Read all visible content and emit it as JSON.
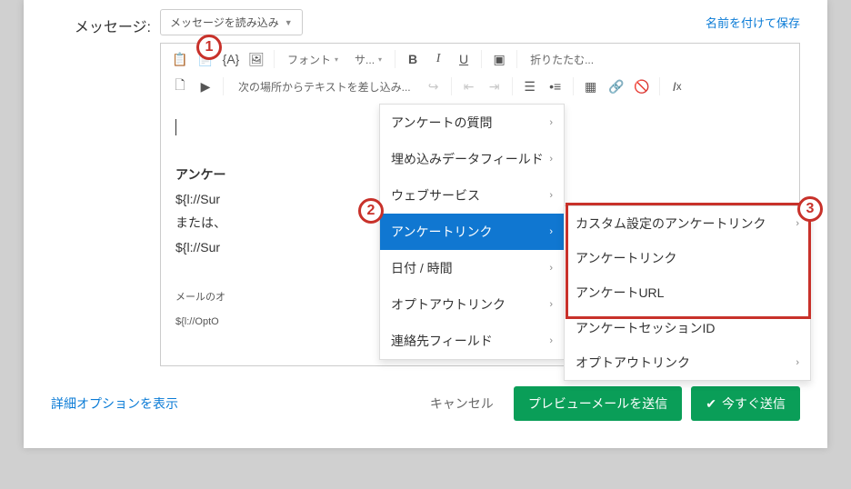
{
  "label": "メッセージ:",
  "loadBtn": "メッセージを読み込み",
  "saveAs": "名前を付けて保存",
  "toolbar": {
    "font": "フォント",
    "size": "サ...",
    "fold": "折りたたむ...",
    "piped": "次の場所からテキストを差し込み..."
  },
  "canvas": {
    "heading1": "アンケー",
    "ref1": "${l://Sur",
    "line2": "または、",
    "ref2": "${l://Sur",
    "small": "メールのオ",
    "ref3": "${l://OptO"
  },
  "menu1": [
    "アンケートの質問",
    "埋め込みデータフィールド",
    "ウェブサービス",
    "アンケートリンク",
    "日付 / 時間",
    "オプトアウトリンク",
    "連絡先フィールド"
  ],
  "menu2": [
    "カスタム設定のアンケートリンク",
    "アンケートリンク",
    "アンケートURL",
    "アンケートセッションID",
    "オプトアウトリンク"
  ],
  "callouts": {
    "n1": "1",
    "n2": "2",
    "n3": "3"
  },
  "footer": {
    "advanced": "詳細オプションを表示",
    "cancel": "キャンセル",
    "preview": "プレビューメールを送信",
    "send": "今すぐ送信"
  }
}
